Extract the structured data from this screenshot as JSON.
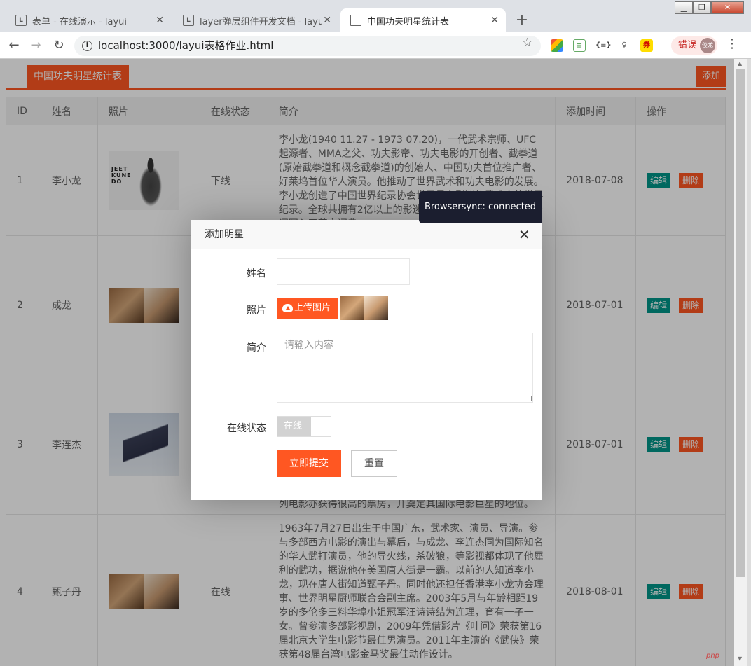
{
  "browser": {
    "tabs": [
      {
        "icon": "L",
        "title": "表单 - 在线演示 - layui"
      },
      {
        "icon": "L",
        "title": "layer弹层组件开发文档 - layui"
      },
      {
        "icon": "",
        "title": "中国功夫明星统计表"
      }
    ],
    "url": "localhost:3000/layui表格作业.html",
    "error_label": "错误",
    "avatar_text": "俊龙"
  },
  "page": {
    "title": "中国功夫明星统计表",
    "add_button": "添加",
    "table": {
      "headers": [
        "ID",
        "姓名",
        "照片",
        "在线状态",
        "简介",
        "添加时间",
        "操作"
      ],
      "edit_label": "编辑",
      "delete_label": "删除",
      "rows": [
        {
          "id": "1",
          "name": "李小龙",
          "status": "下线",
          "date": "2018-07-08",
          "photo_text": "JEET KUNE DO",
          "intro": "李小龙(1940 11.27 - 1973 07.20)，一代武术宗师、UFC起源者、MMA之父、功夫影帝、功夫电影的开创者、截拳道(原始截拳道和概念截拳道)的创始人、中国功夫首位推广者、好莱坞首位华人演员。他推动了世界武术和功夫电影的发展。李小龙创造了中国世界纪录协会世界最多影迷的武术家的世界纪录。全球共拥有2亿以上的影迷。他将 Kung Fu（功夫）一词写入了英文词典。"
        },
        {
          "id": "2",
          "name": "成龙",
          "status": "",
          "date": "2018-07-01",
          "intro": ""
        },
        {
          "id": "3",
          "name": "李连杰",
          "status": "",
          "date": "2018-07-01",
          "intro": "列电影亦获得很高的票房，并奠定其国际电影巨星的地位。"
        },
        {
          "id": "4",
          "name": "甄子丹",
          "status": "在线",
          "date": "2018-08-01",
          "intro": "1963年7月27日出生于中国广东，武术家、演员、导演。参与多部西方电影的演出与幕后，与成龙、李连杰同为国际知名的华人武打演员，他的导火线，杀破狼，等影视都体现了他犀利的武功，据说他在美国唐人街是一霸。以前的人知道李小龙，现在唐人街知道甄子丹。同时他还担任香港李小龙协会理事、世界明星厨师联合会副主席。2003年5月与年龄相距19岁的多伦多三料华埠小姐冠军汪诗诗结为连理，育有一子一女。曾参演多部影视剧，2009年凭借影片《叶问》荣获第16届北京大学生电影节最佳男演员。2011年主演的《武侠》荣获第48届台湾电影金马奖最佳动作设计。"
        }
      ]
    }
  },
  "dialog": {
    "title": "添加明星",
    "name_label": "姓名",
    "name_value": "",
    "photo_label": "照片",
    "upload_label": "上传图片",
    "intro_label": "简介",
    "intro_placeholder": "请输入内容",
    "status_label": "在线状态",
    "status_switch_text": "在线",
    "submit_label": "立即提交",
    "reset_label": "重置"
  },
  "browsersync": "Browsersync: connected",
  "watermark": "php"
}
